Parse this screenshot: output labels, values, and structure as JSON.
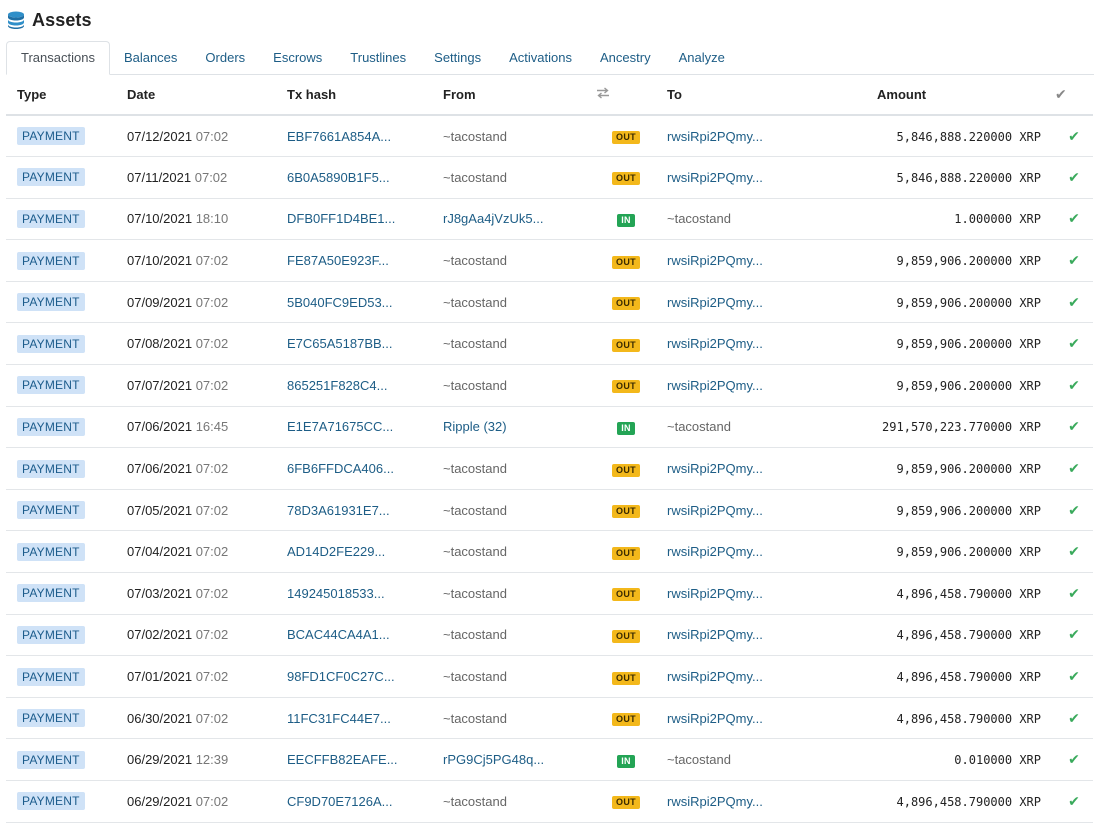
{
  "header": {
    "title": "Assets",
    "icon": "coins-stack-icon"
  },
  "tabs": [
    "Transactions",
    "Balances",
    "Orders",
    "Escrows",
    "Trustlines",
    "Settings",
    "Activations",
    "Ancestry",
    "Analyze"
  ],
  "active_tab": 0,
  "columns": {
    "type": "Type",
    "date": "Date",
    "hash": "Tx hash",
    "from": "From",
    "direction_icon": "swap-arrows-icon",
    "to": "To",
    "amount": "Amount",
    "status_icon": "check-icon"
  },
  "colors": {
    "link": "#1d5d86",
    "out": "#f3b81b",
    "in": "#23a455",
    "type_badge": "#cfe2f7",
    "check": "#3aaa5c"
  },
  "rows": [
    {
      "type": "PAYMENT",
      "date": "07/12/2021",
      "time": "07:02",
      "hash": "EBF7661A854A...",
      "from": "~tacostand",
      "from_link": false,
      "dir": "OUT",
      "to": "rwsiRpi2PQmy...",
      "to_link": true,
      "amount": "5,846,888.220000 XRP"
    },
    {
      "type": "PAYMENT",
      "date": "07/11/2021",
      "time": "07:02",
      "hash": "6B0A5890B1F5...",
      "from": "~tacostand",
      "from_link": false,
      "dir": "OUT",
      "to": "rwsiRpi2PQmy...",
      "to_link": true,
      "amount": "5,846,888.220000 XRP"
    },
    {
      "type": "PAYMENT",
      "date": "07/10/2021",
      "time": "18:10",
      "hash": "DFB0FF1D4BE1...",
      "from": "rJ8gAa4jVzUk5...",
      "from_link": true,
      "dir": "IN",
      "to": "~tacostand",
      "to_link": false,
      "amount": "1.000000 XRP"
    },
    {
      "type": "PAYMENT",
      "date": "07/10/2021",
      "time": "07:02",
      "hash": "FE87A50E923F...",
      "from": "~tacostand",
      "from_link": false,
      "dir": "OUT",
      "to": "rwsiRpi2PQmy...",
      "to_link": true,
      "amount": "9,859,906.200000 XRP"
    },
    {
      "type": "PAYMENT",
      "date": "07/09/2021",
      "time": "07:02",
      "hash": "5B040FC9ED53...",
      "from": "~tacostand",
      "from_link": false,
      "dir": "OUT",
      "to": "rwsiRpi2PQmy...",
      "to_link": true,
      "amount": "9,859,906.200000 XRP"
    },
    {
      "type": "PAYMENT",
      "date": "07/08/2021",
      "time": "07:02",
      "hash": "E7C65A5187BB...",
      "from": "~tacostand",
      "from_link": false,
      "dir": "OUT",
      "to": "rwsiRpi2PQmy...",
      "to_link": true,
      "amount": "9,859,906.200000 XRP"
    },
    {
      "type": "PAYMENT",
      "date": "07/07/2021",
      "time": "07:02",
      "hash": "865251F828C4...",
      "from": "~tacostand",
      "from_link": false,
      "dir": "OUT",
      "to": "rwsiRpi2PQmy...",
      "to_link": true,
      "amount": "9,859,906.200000 XRP"
    },
    {
      "type": "PAYMENT",
      "date": "07/06/2021",
      "time": "16:45",
      "hash": "E1E7A71675CC...",
      "from": "Ripple (32)",
      "from_link": true,
      "dir": "IN",
      "to": "~tacostand",
      "to_link": false,
      "amount": "291,570,223.770000 XRP"
    },
    {
      "type": "PAYMENT",
      "date": "07/06/2021",
      "time": "07:02",
      "hash": "6FB6FFDCA406...",
      "from": "~tacostand",
      "from_link": false,
      "dir": "OUT",
      "to": "rwsiRpi2PQmy...",
      "to_link": true,
      "amount": "9,859,906.200000 XRP"
    },
    {
      "type": "PAYMENT",
      "date": "07/05/2021",
      "time": "07:02",
      "hash": "78D3A61931E7...",
      "from": "~tacostand",
      "from_link": false,
      "dir": "OUT",
      "to": "rwsiRpi2PQmy...",
      "to_link": true,
      "amount": "9,859,906.200000 XRP"
    },
    {
      "type": "PAYMENT",
      "date": "07/04/2021",
      "time": "07:02",
      "hash": "AD14D2FE229...",
      "from": "~tacostand",
      "from_link": false,
      "dir": "OUT",
      "to": "rwsiRpi2PQmy...",
      "to_link": true,
      "amount": "9,859,906.200000 XRP"
    },
    {
      "type": "PAYMENT",
      "date": "07/03/2021",
      "time": "07:02",
      "hash": "149245018533...",
      "from": "~tacostand",
      "from_link": false,
      "dir": "OUT",
      "to": "rwsiRpi2PQmy...",
      "to_link": true,
      "amount": "4,896,458.790000 XRP"
    },
    {
      "type": "PAYMENT",
      "date": "07/02/2021",
      "time": "07:02",
      "hash": "BCAC44CA4A1...",
      "from": "~tacostand",
      "from_link": false,
      "dir": "OUT",
      "to": "rwsiRpi2PQmy...",
      "to_link": true,
      "amount": "4,896,458.790000 XRP"
    },
    {
      "type": "PAYMENT",
      "date": "07/01/2021",
      "time": "07:02",
      "hash": "98FD1CF0C27C...",
      "from": "~tacostand",
      "from_link": false,
      "dir": "OUT",
      "to": "rwsiRpi2PQmy...",
      "to_link": true,
      "amount": "4,896,458.790000 XRP"
    },
    {
      "type": "PAYMENT",
      "date": "06/30/2021",
      "time": "07:02",
      "hash": "11FC31FC44E7...",
      "from": "~tacostand",
      "from_link": false,
      "dir": "OUT",
      "to": "rwsiRpi2PQmy...",
      "to_link": true,
      "amount": "4,896,458.790000 XRP"
    },
    {
      "type": "PAYMENT",
      "date": "06/29/2021",
      "time": "12:39",
      "hash": "EECFFB82EAFE...",
      "from": "rPG9Cj5PG48q...",
      "from_link": true,
      "dir": "IN",
      "to": "~tacostand",
      "to_link": false,
      "amount": "0.010000 XRP"
    },
    {
      "type": "PAYMENT",
      "date": "06/29/2021",
      "time": "07:02",
      "hash": "CF9D70E7126A...",
      "from": "~tacostand",
      "from_link": false,
      "dir": "OUT",
      "to": "rwsiRpi2PQmy...",
      "to_link": true,
      "amount": "4,896,458.790000 XRP"
    }
  ]
}
